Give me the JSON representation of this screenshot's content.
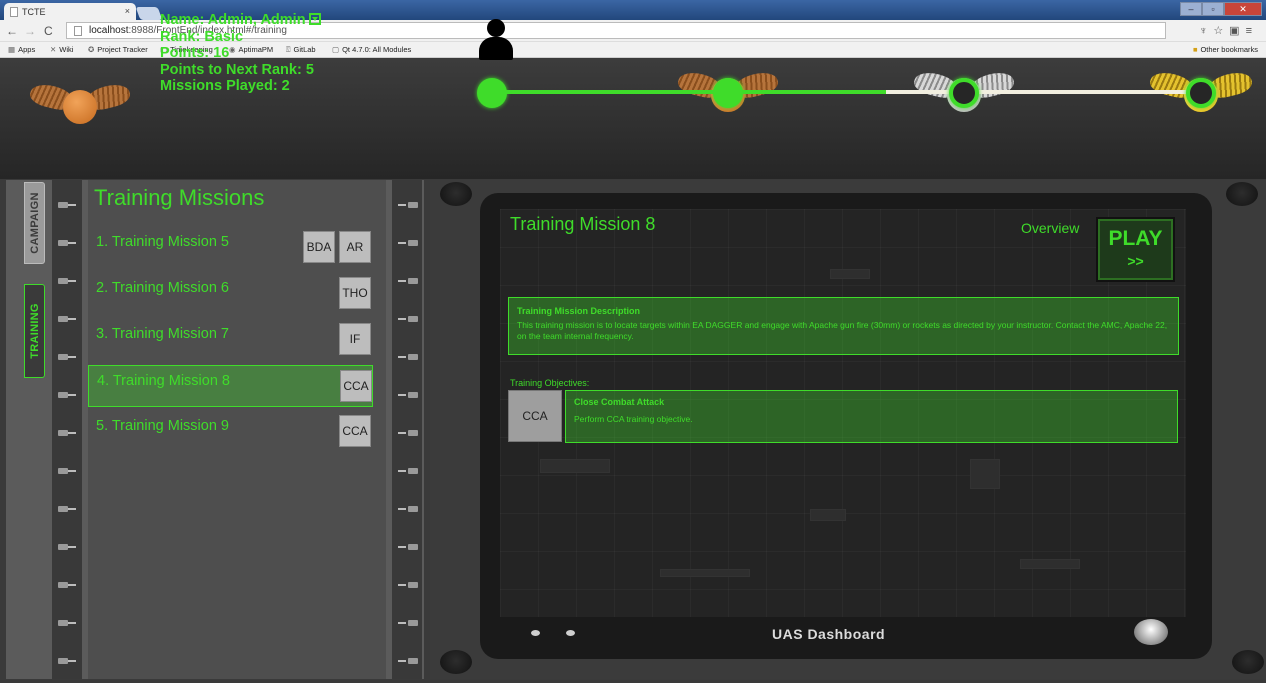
{
  "browser": {
    "tab_title": "TCTE",
    "tab_close": "×",
    "url_host": "localhost",
    "url_rest": ":8988/FrontEnd/index.html#/training",
    "window_buttons": [
      "–",
      "▫",
      "✕"
    ],
    "bookmarks": [
      {
        "label": "Apps",
        "icon": "apps-grid-icon"
      },
      {
        "label": "Wiki",
        "icon": "wiki-icon"
      },
      {
        "label": "Project Tracker",
        "icon": "tracker-icon"
      },
      {
        "label": "Timekeeping",
        "icon": "page-icon"
      },
      {
        "label": "AptimaPM",
        "icon": "aptima-icon"
      },
      {
        "label": "GitLab",
        "icon": "gitlab-icon"
      },
      {
        "label": "Qt 4.7.0: All Modules",
        "icon": "page-icon"
      }
    ],
    "other_bookmarks": "Other bookmarks"
  },
  "profile": {
    "name": "Name: Admin, Admin",
    "rank": "Rank: Basic",
    "points": "Points: 16",
    "points_next": "Points to Next Rank: 5",
    "missions_played": "Missions Played: 2"
  },
  "rank_progress": {
    "completed_steps": 2,
    "total_steps": 4,
    "rank_icons": [
      "person-icon",
      "bronze-wings-icon",
      "silver-wings-icon",
      "gold-wings-icon"
    ]
  },
  "sidebar": {
    "tabs": [
      {
        "label": "CAMPAIGN",
        "active": false
      },
      {
        "label": "TRAINING",
        "active": true
      }
    ]
  },
  "missions": {
    "title": "Training Missions",
    "items": [
      {
        "label": "1. Training Mission 5",
        "tags": [
          "BDA",
          "AR"
        ]
      },
      {
        "label": "2. Training Mission 6",
        "tags": [
          "THO"
        ]
      },
      {
        "label": "3. Training Mission 7",
        "tags": [
          "IF"
        ]
      },
      {
        "label": "4. Training Mission 8",
        "tags": [
          "CCA"
        ]
      },
      {
        "label": "5. Training Mission 9",
        "tags": [
          "CCA"
        ]
      }
    ],
    "selected_index": 3
  },
  "detail": {
    "title": "Training Mission 8",
    "overview": "Overview",
    "play_label": "PLAY",
    "play_arrows": ">>",
    "description_heading": "Training Mission Description",
    "description": "This training mission is to locate targets within EA DAGGER and engage with Apache gun fire (30mm) or rockets as directed by your instructor. Contact the AMC, Apache 22, on the team internal frequency.",
    "objectives_label": "Training Objectives:",
    "objective": {
      "tag": "CCA",
      "heading": "Close Combat Attack",
      "text": "Perform CCA training objective."
    },
    "footer": "UAS Dashboard"
  },
  "colors": {
    "accent": "#3fdc2a",
    "panel": "#5b5b5b",
    "tablet": "#1a1a1a"
  }
}
